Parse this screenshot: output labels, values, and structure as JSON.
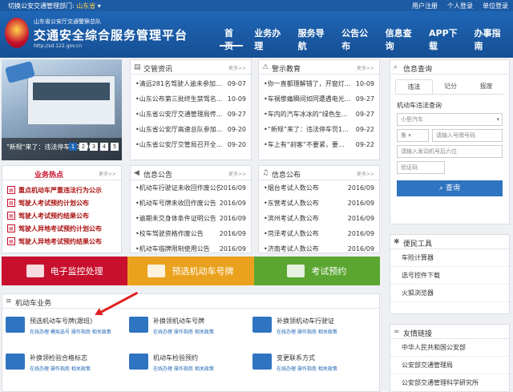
{
  "topbar": {
    "switch_label": "切换公安交通管理部门:",
    "province": "山东省",
    "user_register": "用户注册",
    "personal_login": "个人登录",
    "unit_login": "单位登录"
  },
  "header": {
    "subtitle": "山东省公安厅交通警察总队",
    "title": "交通安全综合服务管理平台",
    "url": "http://sd.122.gov.cn"
  },
  "nav": [
    "首页",
    "业务办理",
    "服务导航",
    "公告公布",
    "信息查询",
    "APP下载",
    "办事指南"
  ],
  "slide": {
    "caption": "\"新规\"来了：违法停车罚1000，...",
    "pages": [
      "1",
      "2",
      "3",
      "4",
      "5"
    ]
  },
  "jiaoguan": {
    "title": "交管资讯",
    "more": "更多>>",
    "items": [
      {
        "t": "•清远281名驾驶人逾未参加...",
        "d": "09-07"
      },
      {
        "t": "•山东公布第三批终生禁驾名...",
        "d": "10-09"
      },
      {
        "t": "•山东省公安厅交通管理局传...",
        "d": "09-27"
      },
      {
        "t": "•山东省公安厅高速总队参加...",
        "d": "09-20"
      },
      {
        "t": "•山东省公安厅交管局召开全...",
        "d": "09-20"
      }
    ]
  },
  "jingshi": {
    "title": "警示教育",
    "more": "更多>>",
    "items": [
      {
        "t": "•你一直都理解错了，开窗灯...",
        "d": "10-09"
      },
      {
        "t": "•车祸惨痛瞬间如同遭遇电光...",
        "d": "09-27"
      },
      {
        "t": "•车内的汽车冰冰的“绿色生...",
        "d": "09-27"
      },
      {
        "t": "•“新规”来了：违法停车罚1...",
        "d": "09-22"
      },
      {
        "t": "•车上有“刹客”不要紧，要...",
        "d": "09-22"
      }
    ]
  },
  "hot": {
    "title": "业务热点",
    "more": "更多>>",
    "items": [
      "重点机动车严重违法行为公示",
      "驾驶人考试预约计划公布",
      "驾驶人考试预约结果公布",
      "驾驶人异地考试预约计划公布",
      "驾驶人异地考试预约结果公布"
    ]
  },
  "gonggao": {
    "title": "信息公告",
    "more": "更多>>",
    "items": [
      {
        "t": "•机动车行驶证未收回作废公告",
        "d": "2016/09"
      },
      {
        "t": "•机动车号牌未收回作废公告",
        "d": "2016/09"
      },
      {
        "t": "•逾期未交身体条件证明公告",
        "d": "2016/09"
      },
      {
        "t": "•校车驾驶资格作废公告",
        "d": "2016/09"
      },
      {
        "t": "•机动车临牌限制使用公告",
        "d": "2016/09"
      }
    ]
  },
  "gongbu": {
    "title": "信息公布",
    "more": "更多>>",
    "items": [
      {
        "t": "•烟台考试人数公布",
        "d": "2016/09"
      },
      {
        "t": "•东营考试人数公布",
        "d": "2016/09"
      },
      {
        "t": "•滨州考试人数公布",
        "d": "2016/09"
      },
      {
        "t": "•菏泽考试人数公布",
        "d": "2016/09"
      },
      {
        "t": "•济南考试人数公布",
        "d": "2016/09"
      }
    ]
  },
  "services": [
    {
      "label": "电子监控处理",
      "color": "#c8102e"
    },
    {
      "label": "预选机动车号牌",
      "color": "#eaa21e"
    },
    {
      "label": "考试预约",
      "color": "#5aa631"
    }
  ],
  "vehicle": {
    "title": "机动车业务",
    "items": [
      {
        "name": "预选机动车号牌(跟班)",
        "links": "在线办理 模拟选号 操作指南 相关政策"
      },
      {
        "name": "补换领机动车号牌",
        "links": "在线办理 操作指南 相关政策"
      },
      {
        "name": "补换领机动车行驶证",
        "links": "在线办理 操作指南 相关政策"
      },
      {
        "name": "补换领检验合格标志",
        "links": "在线办理 操作指南 相关政策"
      },
      {
        "name": "机动车检验预约",
        "links": "在线办理 操作指南 相关政策"
      },
      {
        "name": "变更联系方式",
        "links": "在线办理 操作指南 相关政策"
      }
    ]
  },
  "query": {
    "title": "信息查询",
    "tabs": [
      "违法",
      "记分",
      "报废"
    ],
    "label": "机动车违法查询",
    "vehicle_type": "小型汽车",
    "plate_prefix": "鲁",
    "plate_placeholder": "请输入号牌号码",
    "engine_placeholder": "请输入发动机号后六位",
    "captcha_placeholder": "验证码",
    "button": "查询"
  },
  "tools": {
    "title": "便民工具",
    "items": [
      "车险计算器",
      "选号控件下载",
      "火狐浏览器"
    ]
  },
  "links": {
    "title": "友情链接",
    "items": [
      "中华人民共和国公安部",
      "公安部交通管理局",
      "公安部交通管理科学研究所"
    ]
  }
}
